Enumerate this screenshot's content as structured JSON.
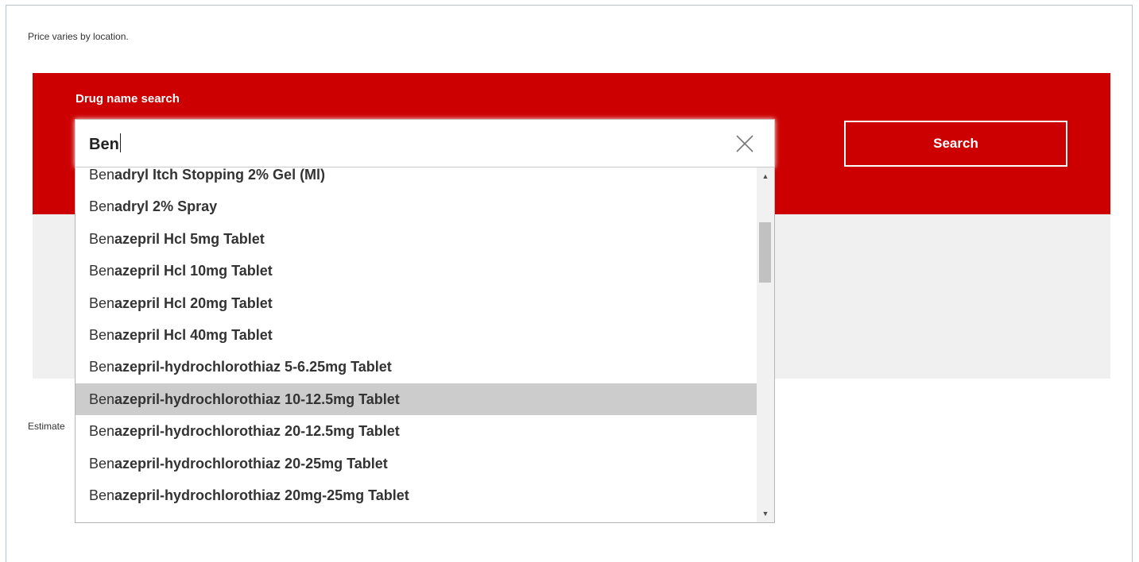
{
  "page": {
    "price_note": "Price varies by location.",
    "estimate_text": "Estimate"
  },
  "search": {
    "label": "Drug name search",
    "value": "Ben",
    "button_label": "Search"
  },
  "icons": {
    "clear": "close-icon",
    "scroll_up": "arrow-up-icon",
    "scroll_down": "arrow-down-icon"
  },
  "colors": {
    "brand_red": "#cc0000",
    "highlight": "#cccccc",
    "panel_grey": "#f0f0f0"
  },
  "dropdown": {
    "highlighted_index": 7,
    "items": [
      {
        "prefix": "Ben",
        "rest": "adryl Itch Stopping 2% Gel (Ml)"
      },
      {
        "prefix": "Ben",
        "rest": "adryl 2% Spray"
      },
      {
        "prefix": "Ben",
        "rest": "azepril Hcl 5mg Tablet"
      },
      {
        "prefix": "Ben",
        "rest": "azepril Hcl 10mg Tablet"
      },
      {
        "prefix": "Ben",
        "rest": "azepril Hcl 20mg Tablet"
      },
      {
        "prefix": "Ben",
        "rest": "azepril Hcl 40mg Tablet"
      },
      {
        "prefix": "Ben",
        "rest": "azepril-hydrochlorothiaz 5-6.25mg Tablet"
      },
      {
        "prefix": "Ben",
        "rest": "azepril-hydrochlorothiaz 10-12.5mg Tablet"
      },
      {
        "prefix": "Ben",
        "rest": "azepril-hydrochlorothiaz 20-12.5mg Tablet"
      },
      {
        "prefix": "Ben",
        "rest": "azepril-hydrochlorothiaz 20-25mg Tablet"
      },
      {
        "prefix": "Ben",
        "rest": "azepril-hydrochlorothiaz 20mg-25mg Tablet"
      }
    ],
    "scroll_position": 0.2
  }
}
